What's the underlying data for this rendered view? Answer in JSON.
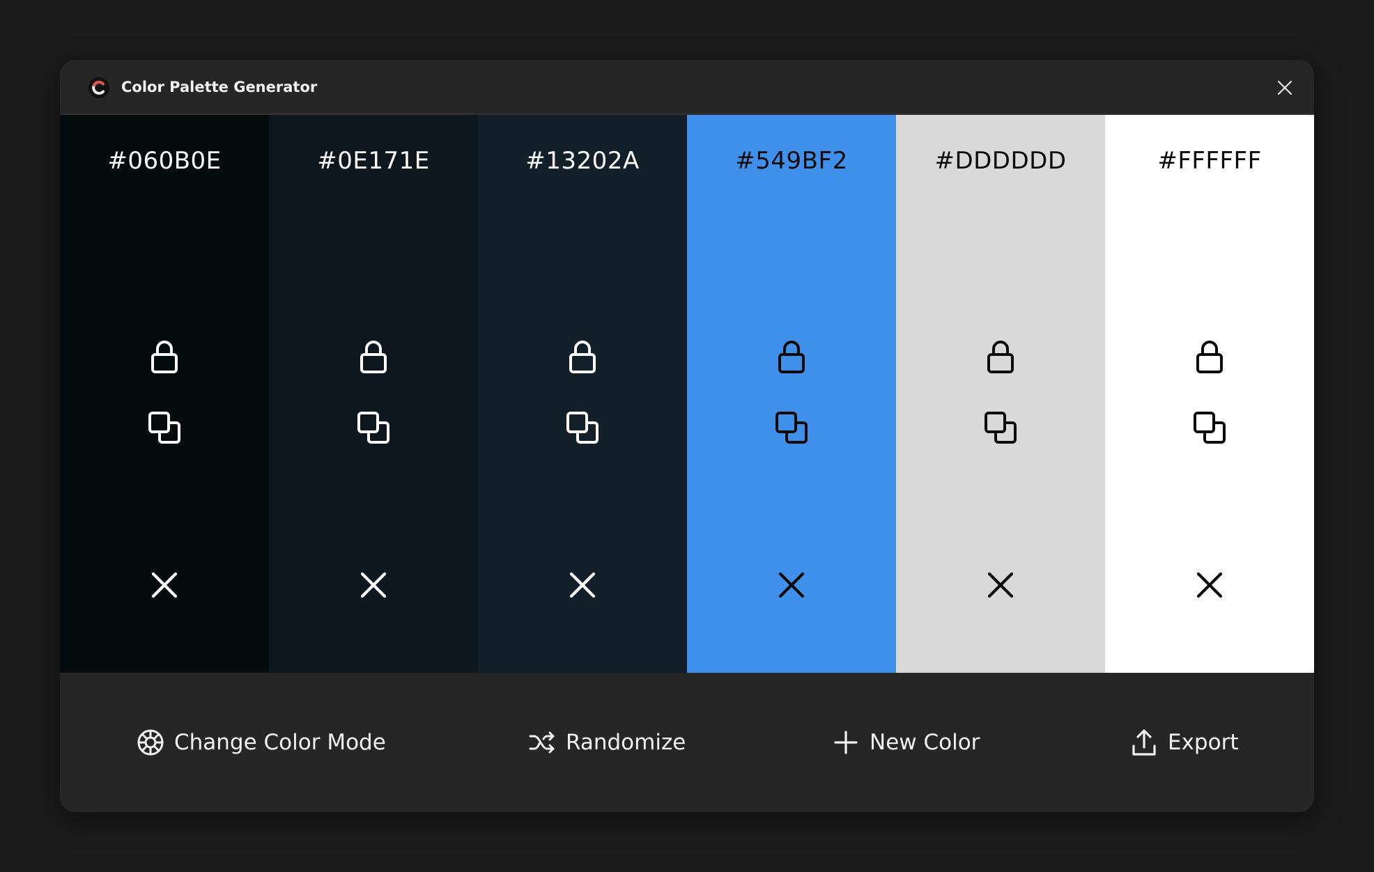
{
  "window": {
    "title": "Color Palette Generator"
  },
  "palette": [
    {
      "hex": "#060B0E",
      "bg": "#060B0E",
      "fg": "#ffffff"
    },
    {
      "hex": "#0E171E",
      "bg": "#0E171E",
      "fg": "#ffffff"
    },
    {
      "hex": "#13202A",
      "bg": "#13202A",
      "fg": "#ffffff"
    },
    {
      "hex": "#549BF2",
      "bg": "#3F90EB",
      "fg": "#0b0b0b"
    },
    {
      "hex": "#DDDDDD",
      "bg": "#D9D9D9",
      "fg": "#0b0b0b"
    },
    {
      "hex": "#FFFFFF",
      "bg": "#FFFFFF",
      "fg": "#0b0b0b"
    }
  ],
  "toolbar": {
    "change_mode_label": "Change Color Mode",
    "randomize_label": "Randomize",
    "new_color_label": "New Color",
    "export_label": "Export"
  },
  "icons": {
    "app_logo": "app-logo-icon",
    "close": "close-icon",
    "lock": "lock-icon",
    "copy": "copy-icon",
    "remove": "remove-icon",
    "color_mode": "color-wheel-icon",
    "shuffle": "shuffle-icon",
    "plus": "plus-icon",
    "upload": "upload-icon"
  }
}
